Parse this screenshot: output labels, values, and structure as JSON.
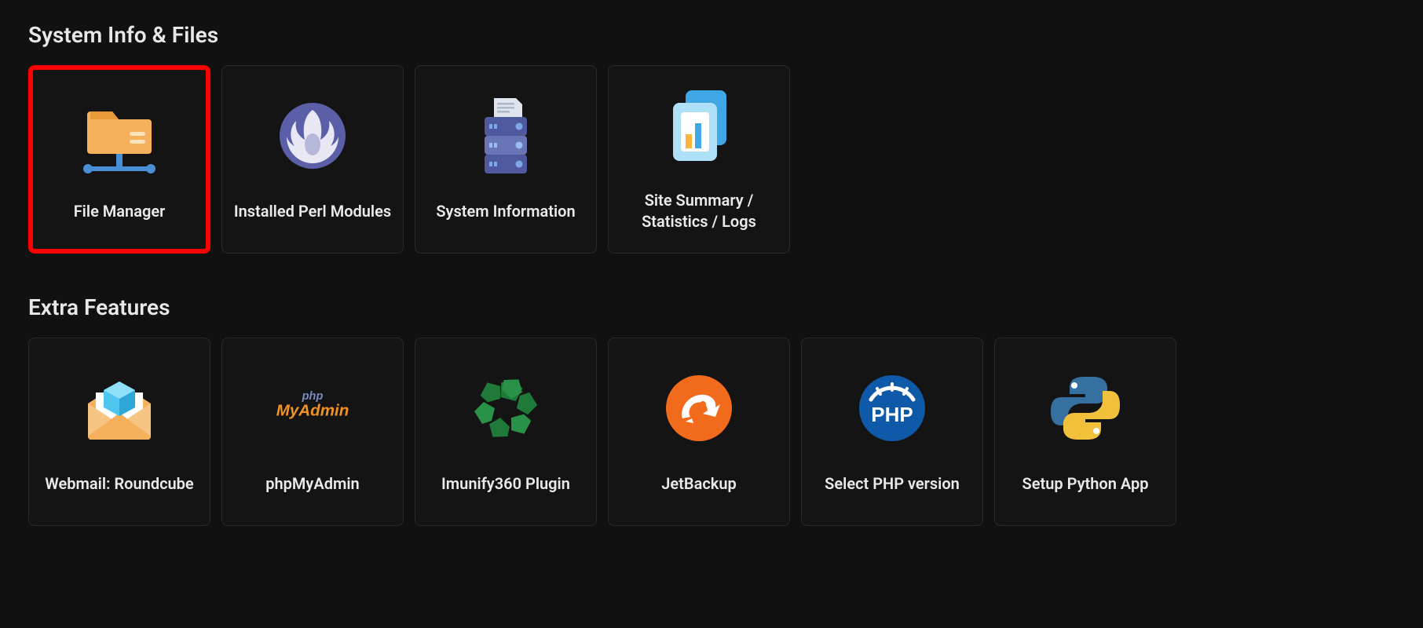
{
  "sections": [
    {
      "title": "System Info & Files",
      "items": [
        {
          "label": "File Manager",
          "icon": "folder-network-icon",
          "highlight": true
        },
        {
          "label": "Installed Perl Modules",
          "icon": "perl-icon",
          "highlight": false
        },
        {
          "label": "System Information",
          "icon": "server-icon",
          "highlight": false
        },
        {
          "label": "Site Summary / Statistics / Logs",
          "icon": "stats-icon",
          "highlight": false
        }
      ]
    },
    {
      "title": "Extra Features",
      "items": [
        {
          "label": "Webmail: Roundcube",
          "icon": "roundcube-icon",
          "highlight": false
        },
        {
          "label": "phpMyAdmin",
          "icon": "phpmyadmin-icon",
          "highlight": false
        },
        {
          "label": "Imunify360 Plugin",
          "icon": "imunify-icon",
          "highlight": false
        },
        {
          "label": "JetBackup",
          "icon": "jetbackup-icon",
          "highlight": false
        },
        {
          "label": "Select PHP version",
          "icon": "php-icon",
          "highlight": false
        },
        {
          "label": "Setup Python App",
          "icon": "python-icon",
          "highlight": false
        }
      ]
    }
  ]
}
